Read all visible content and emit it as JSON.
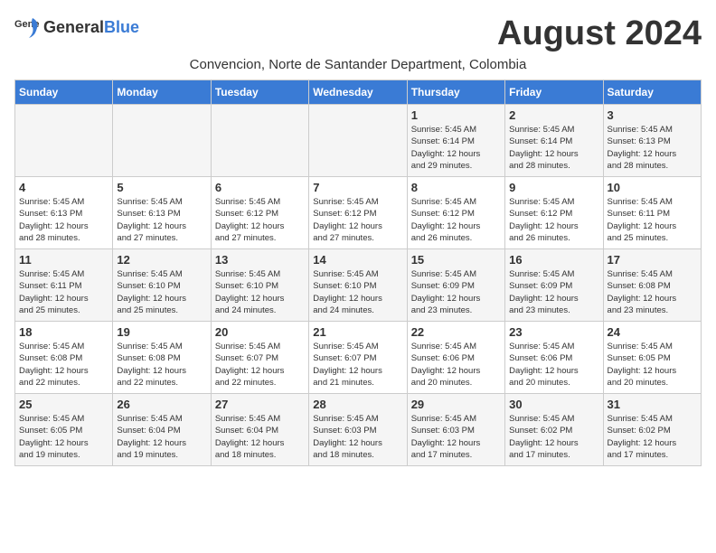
{
  "header": {
    "logo_general": "General",
    "logo_blue": "Blue",
    "month_year": "August 2024",
    "location": "Convencion, Norte de Santander Department, Colombia"
  },
  "weekdays": [
    "Sunday",
    "Monday",
    "Tuesday",
    "Wednesday",
    "Thursday",
    "Friday",
    "Saturday"
  ],
  "weeks": [
    [
      {
        "day": "",
        "info": ""
      },
      {
        "day": "",
        "info": ""
      },
      {
        "day": "",
        "info": ""
      },
      {
        "day": "",
        "info": ""
      },
      {
        "day": "1",
        "info": "Sunrise: 5:45 AM\nSunset: 6:14 PM\nDaylight: 12 hours\nand 29 minutes."
      },
      {
        "day": "2",
        "info": "Sunrise: 5:45 AM\nSunset: 6:14 PM\nDaylight: 12 hours\nand 28 minutes."
      },
      {
        "day": "3",
        "info": "Sunrise: 5:45 AM\nSunset: 6:13 PM\nDaylight: 12 hours\nand 28 minutes."
      }
    ],
    [
      {
        "day": "4",
        "info": "Sunrise: 5:45 AM\nSunset: 6:13 PM\nDaylight: 12 hours\nand 28 minutes."
      },
      {
        "day": "5",
        "info": "Sunrise: 5:45 AM\nSunset: 6:13 PM\nDaylight: 12 hours\nand 27 minutes."
      },
      {
        "day": "6",
        "info": "Sunrise: 5:45 AM\nSunset: 6:12 PM\nDaylight: 12 hours\nand 27 minutes."
      },
      {
        "day": "7",
        "info": "Sunrise: 5:45 AM\nSunset: 6:12 PM\nDaylight: 12 hours\nand 27 minutes."
      },
      {
        "day": "8",
        "info": "Sunrise: 5:45 AM\nSunset: 6:12 PM\nDaylight: 12 hours\nand 26 minutes."
      },
      {
        "day": "9",
        "info": "Sunrise: 5:45 AM\nSunset: 6:12 PM\nDaylight: 12 hours\nand 26 minutes."
      },
      {
        "day": "10",
        "info": "Sunrise: 5:45 AM\nSunset: 6:11 PM\nDaylight: 12 hours\nand 25 minutes."
      }
    ],
    [
      {
        "day": "11",
        "info": "Sunrise: 5:45 AM\nSunset: 6:11 PM\nDaylight: 12 hours\nand 25 minutes."
      },
      {
        "day": "12",
        "info": "Sunrise: 5:45 AM\nSunset: 6:10 PM\nDaylight: 12 hours\nand 25 minutes."
      },
      {
        "day": "13",
        "info": "Sunrise: 5:45 AM\nSunset: 6:10 PM\nDaylight: 12 hours\nand 24 minutes."
      },
      {
        "day": "14",
        "info": "Sunrise: 5:45 AM\nSunset: 6:10 PM\nDaylight: 12 hours\nand 24 minutes."
      },
      {
        "day": "15",
        "info": "Sunrise: 5:45 AM\nSunset: 6:09 PM\nDaylight: 12 hours\nand 23 minutes."
      },
      {
        "day": "16",
        "info": "Sunrise: 5:45 AM\nSunset: 6:09 PM\nDaylight: 12 hours\nand 23 minutes."
      },
      {
        "day": "17",
        "info": "Sunrise: 5:45 AM\nSunset: 6:08 PM\nDaylight: 12 hours\nand 23 minutes."
      }
    ],
    [
      {
        "day": "18",
        "info": "Sunrise: 5:45 AM\nSunset: 6:08 PM\nDaylight: 12 hours\nand 22 minutes."
      },
      {
        "day": "19",
        "info": "Sunrise: 5:45 AM\nSunset: 6:08 PM\nDaylight: 12 hours\nand 22 minutes."
      },
      {
        "day": "20",
        "info": "Sunrise: 5:45 AM\nSunset: 6:07 PM\nDaylight: 12 hours\nand 22 minutes."
      },
      {
        "day": "21",
        "info": "Sunrise: 5:45 AM\nSunset: 6:07 PM\nDaylight: 12 hours\nand 21 minutes."
      },
      {
        "day": "22",
        "info": "Sunrise: 5:45 AM\nSunset: 6:06 PM\nDaylight: 12 hours\nand 20 minutes."
      },
      {
        "day": "23",
        "info": "Sunrise: 5:45 AM\nSunset: 6:06 PM\nDaylight: 12 hours\nand 20 minutes."
      },
      {
        "day": "24",
        "info": "Sunrise: 5:45 AM\nSunset: 6:05 PM\nDaylight: 12 hours\nand 20 minutes."
      }
    ],
    [
      {
        "day": "25",
        "info": "Sunrise: 5:45 AM\nSunset: 6:05 PM\nDaylight: 12 hours\nand 19 minutes."
      },
      {
        "day": "26",
        "info": "Sunrise: 5:45 AM\nSunset: 6:04 PM\nDaylight: 12 hours\nand 19 minutes."
      },
      {
        "day": "27",
        "info": "Sunrise: 5:45 AM\nSunset: 6:04 PM\nDaylight: 12 hours\nand 18 minutes."
      },
      {
        "day": "28",
        "info": "Sunrise: 5:45 AM\nSunset: 6:03 PM\nDaylight: 12 hours\nand 18 minutes."
      },
      {
        "day": "29",
        "info": "Sunrise: 5:45 AM\nSunset: 6:03 PM\nDaylight: 12 hours\nand 17 minutes."
      },
      {
        "day": "30",
        "info": "Sunrise: 5:45 AM\nSunset: 6:02 PM\nDaylight: 12 hours\nand 17 minutes."
      },
      {
        "day": "31",
        "info": "Sunrise: 5:45 AM\nSunset: 6:02 PM\nDaylight: 12 hours\nand 17 minutes."
      }
    ]
  ]
}
